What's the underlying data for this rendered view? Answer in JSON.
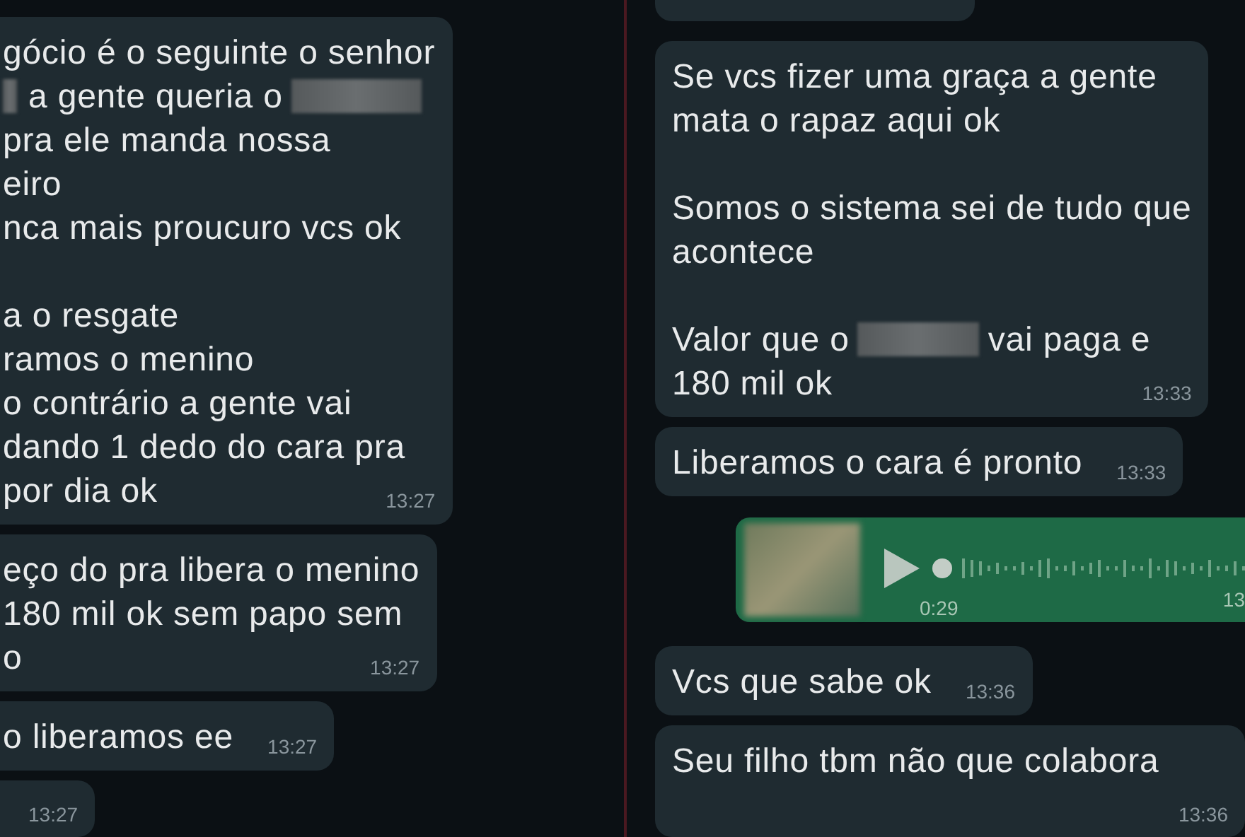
{
  "panels": [
    {
      "messages": [
        {
          "kind": "text",
          "paragraphs": [
            [
              "gócio é o seguinte o senhor",
              [
                {
                  "kind": "blur"
                },
                {
                  "kind": "text",
                  "text": "a gente queria o"
                },
                {
                  "kind": "blur"
                }
              ],
              "pra ele manda nossa",
              "eiro",
              "nca mais proucuro vcs ok"
            ],
            [
              "a o resgate",
              "ramos o menino",
              "o contrário  a gente vai",
              "dando 1 dedo do cara pra",
              "por dia ok"
            ]
          ],
          "time": "13:27"
        },
        {
          "kind": "text",
          "paragraphs": [
            [
              "eço do pra libera o menino",
              "180 mil ok sem papo sem",
              "o"
            ]
          ],
          "time": "13:27"
        },
        {
          "kind": "text",
          "paragraphs": [
            [
              "o liberamos ee"
            ]
          ],
          "time": "13:27"
        },
        {
          "kind": "text",
          "time": "13:27"
        }
      ]
    },
    {
      "messages": [
        {
          "kind": "clipped"
        },
        {
          "kind": "text",
          "paragraphs": [
            [
              "Se vcs fizer uma graça a gente",
              "mata o rapaz aqui ok"
            ],
            [
              "Somos o sistema sei de tudo que",
              "acontece"
            ],
            [
              [
                {
                  "kind": "text",
                  "text": "Valor que o"
                },
                {
                  "kind": "blur"
                },
                {
                  "kind": "text",
                  "text": "vai paga e"
                }
              ],
              "180 mil ok"
            ]
          ],
          "time": "13:33"
        },
        {
          "kind": "text",
          "paragraphs": [
            [
              "Liberamos o cara é pronto"
            ]
          ],
          "time": "13:33"
        },
        {
          "kind": "voice",
          "duration": "0:29",
          "time": "13"
        },
        {
          "kind": "text",
          "paragraphs": [
            [
              "Vcs que sabe ok"
            ]
          ],
          "time": "13:36"
        },
        {
          "kind": "text",
          "paragraphs": [
            [
              "Seu filho tbm não que colabora"
            ]
          ],
          "time": "13:36"
        }
      ]
    }
  ]
}
